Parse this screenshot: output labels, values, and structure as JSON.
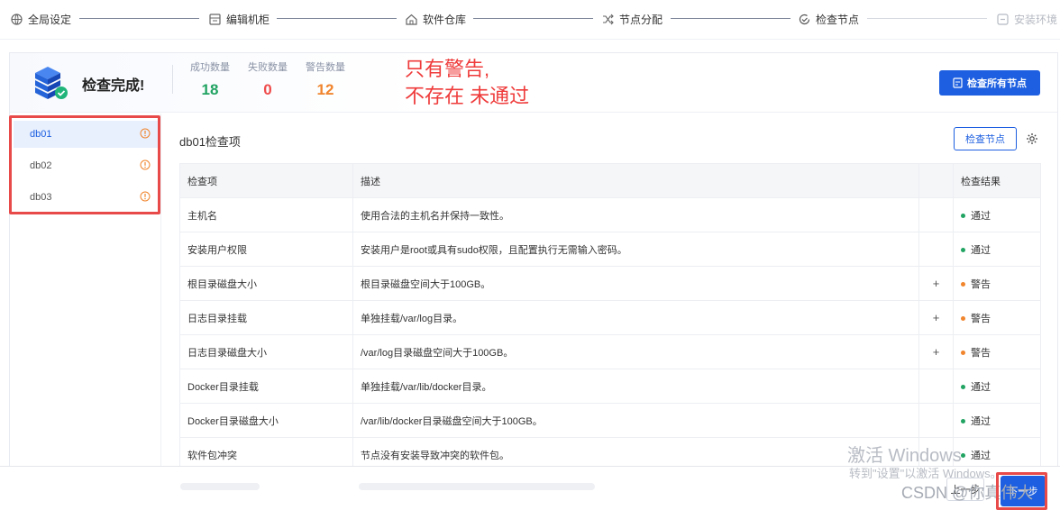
{
  "steps": [
    {
      "label": "全局设定",
      "icon": "globe-icon",
      "state": "done"
    },
    {
      "label": "编辑机柜",
      "icon": "cabinet-icon",
      "state": "done"
    },
    {
      "label": "软件仓库",
      "icon": "house-icon",
      "state": "done"
    },
    {
      "label": "节点分配",
      "icon": "shuffle-icon",
      "state": "done"
    },
    {
      "label": "检查节点",
      "icon": "check-refresh-icon",
      "state": "active"
    },
    {
      "label": "安装环境",
      "icon": "install-icon",
      "state": "disabled"
    }
  ],
  "header": {
    "title": "检查完成!",
    "stats": [
      {
        "label": "成功数量",
        "value": "18",
        "color": "#21a362"
      },
      {
        "label": "失败数量",
        "value": "0",
        "color": "#ef4b4b"
      },
      {
        "label": "警告数量",
        "value": "12",
        "color": "#f0852d"
      }
    ],
    "check_all_label": "检查所有节点"
  },
  "annotation": {
    "line1": "只有警告,",
    "line2": "不存在 未通过"
  },
  "nodes": [
    {
      "name": "db01",
      "selected": true,
      "status": "warning"
    },
    {
      "name": "db02",
      "selected": false,
      "status": "warning"
    },
    {
      "name": "db03",
      "selected": false,
      "status": "warning"
    }
  ],
  "content": {
    "title": "db01检查项",
    "check_node_label": "检查节点",
    "columns": [
      "检查项",
      "描述",
      "",
      "检查结果"
    ],
    "rows": [
      {
        "item": "主机名",
        "desc": "使用合法的主机名并保持一致性。",
        "op": "",
        "result": "通过",
        "status": "pass"
      },
      {
        "item": "安装用户权限",
        "desc": "安装用户是root或具有sudo权限，且配置执行无需输入密码。",
        "op": "",
        "result": "通过",
        "status": "pass"
      },
      {
        "item": "根目录磁盘大小",
        "desc": "根目录磁盘空间大于100GB。",
        "op": "+",
        "result": "警告",
        "status": "warn"
      },
      {
        "item": "日志目录挂载",
        "desc": "单独挂载/var/log目录。",
        "op": "+",
        "result": "警告",
        "status": "warn"
      },
      {
        "item": "日志目录磁盘大小",
        "desc": "/var/log目录磁盘空间大于100GB。",
        "op": "+",
        "result": "警告",
        "status": "warn"
      },
      {
        "item": "Docker目录挂载",
        "desc": "单独挂载/var/lib/docker目录。",
        "op": "",
        "result": "通过",
        "status": "pass"
      },
      {
        "item": "Docker目录磁盘大小",
        "desc": "/var/lib/docker目录磁盘空间大于100GB。",
        "op": "",
        "result": "通过",
        "status": "pass"
      },
      {
        "item": "软件包冲突",
        "desc": "节点没有安装导致冲突的软件包。",
        "op": "",
        "result": "通过",
        "status": "pass"
      }
    ]
  },
  "footer": {
    "prev_label": "上一步",
    "next_label": "下一步"
  },
  "watermark": {
    "line1": "激活 Windows",
    "line2": "转到\"设置\"以激活 Windows。",
    "line3": "CSDN @你真伟大"
  },
  "colors": {
    "primary": "#1d5fe0",
    "pass": "#21a362",
    "warn": "#f0852d",
    "annotation": "#ef3b3b"
  }
}
